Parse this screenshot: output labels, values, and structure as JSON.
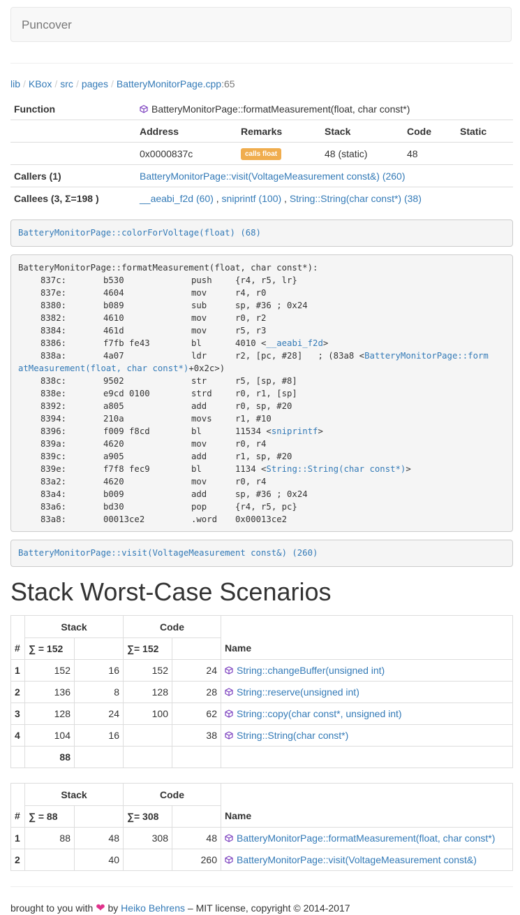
{
  "navbar": {
    "brand": "Puncover"
  },
  "breadcrumb": {
    "items": [
      "lib",
      "KBox",
      "src",
      "pages",
      "BatteryMonitorPage.cpp"
    ],
    "line_suffix": ":65"
  },
  "info": {
    "function_label": "Function",
    "function_name": "BatteryMonitorPage::formatMeasurement(float, char const*)",
    "columns": [
      "Address",
      "Remarks",
      "Stack",
      "Code",
      "Static"
    ],
    "address": "0x0000837c",
    "remarks_badge": "calls float",
    "stack": "48 (static)",
    "code": "48",
    "static": "",
    "callers_label": "Callers (1)",
    "callers": [
      "BatteryMonitorPage::visit(VoltageMeasurement const&) (260)"
    ],
    "callees_label": "Callees (3, Σ=198 )",
    "callees": [
      "__aeabi_f2d (60)",
      "sniprintf (100)",
      "String::String(char const*) (38)"
    ],
    "callees_sep": " , "
  },
  "prev_function": "BatteryMonitorPage::colorForVoltage(float) (68)",
  "next_function": "BatteryMonitorPage::visit(VoltageMeasurement const&) (260)",
  "asm": {
    "header": "BatteryMonitorPage::formatMeasurement(float, char const*):",
    "lines": [
      {
        "addr": "837c:",
        "hex": "b530",
        "op": "push",
        "args": "{r4, r5, lr}"
      },
      {
        "addr": "837e:",
        "hex": "4604",
        "op": "mov",
        "args": "r4, r0"
      },
      {
        "addr": "8380:",
        "hex": "b089",
        "op": "sub",
        "args": "sp, #36 ; 0x24"
      },
      {
        "addr": "8382:",
        "hex": "4610",
        "op": "mov",
        "args": "r0, r2"
      },
      {
        "addr": "8384:",
        "hex": "461d",
        "op": "mov",
        "args": "r5, r3"
      },
      {
        "addr": "8386:",
        "hex": "f7fb fe43",
        "op": "bl",
        "args": "4010 <",
        "link": "__aeabi_f2d",
        "tail": ">"
      },
      {
        "addr": "838a:",
        "hex": "4a07",
        "op": "ldr",
        "args": "r2, [pc, #28]   ; (83a8 <",
        "link": "BatteryMonitorPage::form",
        "tail": ""
      },
      {
        "cont": true,
        "link": "atMeasurement(float, char const*)",
        "tail": "+0x2c>)"
      },
      {
        "addr": "838c:",
        "hex": "9502",
        "op": "str",
        "args": "r5, [sp, #8]"
      },
      {
        "addr": "838e:",
        "hex": "e9cd 0100",
        "op": "strd",
        "args": "r0, r1, [sp]"
      },
      {
        "addr": "8392:",
        "hex": "a805",
        "op": "add",
        "args": "r0, sp, #20"
      },
      {
        "addr": "8394:",
        "hex": "210a",
        "op": "movs",
        "args": "r1, #10"
      },
      {
        "addr": "8396:",
        "hex": "f009 f8cd",
        "op": "bl",
        "args": "11534 <",
        "link": "sniprintf",
        "tail": ">"
      },
      {
        "addr": "839a:",
        "hex": "4620",
        "op": "mov",
        "args": "r0, r4"
      },
      {
        "addr": "839c:",
        "hex": "a905",
        "op": "add",
        "args": "r1, sp, #20"
      },
      {
        "addr": "839e:",
        "hex": "f7f8 fec9",
        "op": "bl",
        "args": "1134 <",
        "link": "String::String(char const*)",
        "tail": ">"
      },
      {
        "addr": "83a2:",
        "hex": "4620",
        "op": "mov",
        "args": "r0, r4"
      },
      {
        "addr": "83a4:",
        "hex": "b009",
        "op": "add",
        "args": "sp, #36 ; 0x24"
      },
      {
        "addr": "83a6:",
        "hex": "bd30",
        "op": "pop",
        "args": "{r4, r5, pc}"
      },
      {
        "addr": "83a8:",
        "hex": "00013ce2",
        "op": ".word",
        "args": "0x00013ce2"
      }
    ]
  },
  "section_title": "Stack Worst-Case Scenarios",
  "scenario1": {
    "stack_header": "Stack",
    "code_header": "Code",
    "hash": "#",
    "name_header": "Name",
    "stack_sum": "∑ = 152",
    "code_sum": "∑= 152",
    "rows": [
      {
        "n": "1",
        "s1": "152",
        "s2": "16",
        "c1": "152",
        "c2": "24",
        "name": "String::changeBuffer(unsigned int)"
      },
      {
        "n": "2",
        "s1": "136",
        "s2": "8",
        "c1": "128",
        "c2": "28",
        "name": "String::reserve(unsigned int)"
      },
      {
        "n": "3",
        "s1": "128",
        "s2": "24",
        "c1": "100",
        "c2": "62",
        "name": "String::copy(char const*, unsigned int)"
      },
      {
        "n": "4",
        "s1": "104",
        "s2": "16",
        "c1": "",
        "c2": "38",
        "name": "String::String(char const*)"
      }
    ],
    "total": "88"
  },
  "scenario2": {
    "stack_header": "Stack",
    "code_header": "Code",
    "hash": "#",
    "name_header": "Name",
    "stack_sum": "∑ = 88",
    "code_sum": "∑= 308",
    "rows": [
      {
        "n": "1",
        "s1": "88",
        "s2": "48",
        "c1": "308",
        "c2": "48",
        "name": "BatteryMonitorPage::formatMeasurement(float, char const*)"
      },
      {
        "n": "2",
        "s1": "",
        "s2": "40",
        "c1": "",
        "c2": "260",
        "name": "BatteryMonitorPage::visit(VoltageMeasurement const&)"
      }
    ]
  },
  "footer": {
    "prefix": "brought to you with ",
    "by": " by ",
    "author": "Heiko Behrens",
    "suffix": " – MIT license, copyright © 2014-2017"
  }
}
